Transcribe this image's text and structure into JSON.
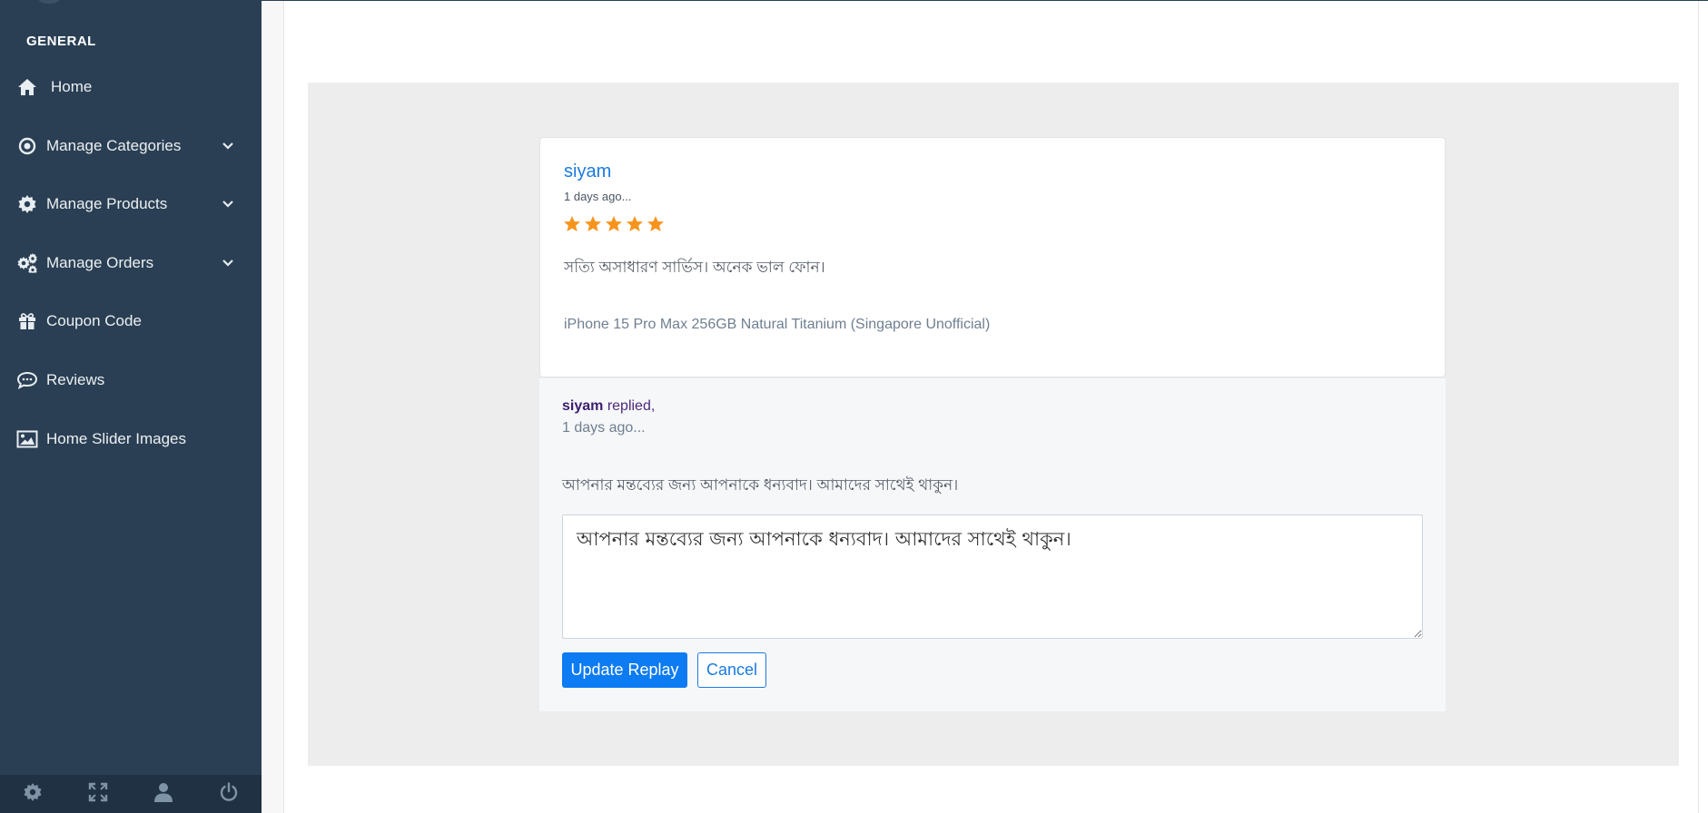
{
  "sidebar": {
    "section_title": "GENERAL",
    "items": [
      {
        "label": "Home",
        "icon": "home-icon",
        "has_submenu": false
      },
      {
        "label": "Manage Categories",
        "icon": "target-icon",
        "has_submenu": true
      },
      {
        "label": "Manage Products",
        "icon": "gear-icon",
        "has_submenu": true
      },
      {
        "label": "Manage Orders",
        "icon": "gears-icon",
        "has_submenu": true
      },
      {
        "label": "Coupon Code",
        "icon": "gift-icon",
        "has_submenu": false
      },
      {
        "label": "Reviews",
        "icon": "comment-icon",
        "has_submenu": false
      },
      {
        "label": "Home Slider Images",
        "icon": "image-icon",
        "has_submenu": false
      }
    ],
    "footer_icons": [
      "settings-icon",
      "fullscreen-icon",
      "user-icon",
      "power-icon"
    ]
  },
  "review": {
    "author": "siyam",
    "time": "1 days ago...",
    "rating": 5,
    "max_rating": 5,
    "comment": "সত্যি অসাধারণ সার্ভিস। অনেক ভাল ফোন।",
    "product": "iPhone 15 Pro Max 256GB Natural Titanium (Singapore Unofficial)"
  },
  "reply": {
    "author": "siyam",
    "replied_word": " replied,",
    "time": "1 days ago...",
    "text": "আপনার মন্তব্যের জন্য আপনাকে ধন্যবাদ। আমাদের সাথেই থাকুন।",
    "textarea_value": "আপনার মন্তব্যের জন্য আপনাকে ধন্যবাদ। আমাদের সাথেই থাকুন।",
    "update_label": "Update Replay",
    "cancel_label": "Cancel"
  },
  "colors": {
    "sidebar_bg": "#2a3f54",
    "star": "#f7941d",
    "primary": "#0d7bf2",
    "link": "#1a7ae0"
  }
}
